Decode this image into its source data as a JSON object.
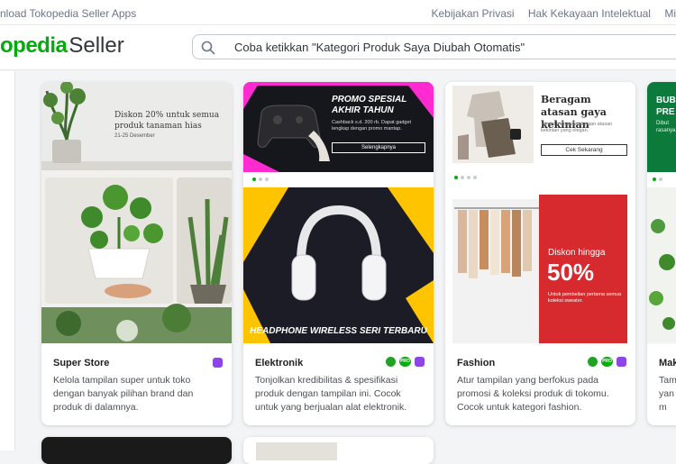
{
  "topbar": {
    "download_link": "nload Tokopedia Seller Apps",
    "privacy": "Kebijakan Privasi",
    "ip": "Hak Kekayaan Intelektual",
    "more": "Mi"
  },
  "header": {
    "logo_brand": "opedia",
    "logo_seller": "Seller",
    "search_placeholder": "Coba ketikkan \"Kategori Produk Saya Diubah Otomatis\""
  },
  "cards": [
    {
      "title": "Super Store",
      "description": "Kelola tampilan super untuk toko dengan banyak pilihan brand dan produk di dalamnya.",
      "banner_text": "Diskon 20% untuk semua produk tanaman hias",
      "banner_date": "21-25 Desember"
    },
    {
      "title": "Elektronik",
      "description": "Tonjolkan kredibilitas & spesifikasi produk dengan tampilan ini. Cocok untuk yang berjualan alat elektronik.",
      "promo_title": "PROMO SPESIAL AKHIR TAHUN",
      "promo_body": "Cashback s.d. 200 rb. Dapat gadget lengkap dengan promo mantap.",
      "promo_btn": "Selengkapnya",
      "headphone_text": "HEADPHONE WIRELESS SERI TERBARU"
    },
    {
      "title": "Fashion",
      "description": "Atur tampilan yang berfokus pada promosi & koleksi produk di tokomu. Cocok untuk kategori fashion.",
      "banner_title": "Beragam atasan gaya kekinian",
      "banner_body": "Tampil menawan dengan atasan kekinian yang elegan.",
      "banner_btn": "Cek Sekarang",
      "sale_label": "Diskon hingga",
      "sale_value": "50%",
      "sale_note": "Untuk pembelian pertama semua koleksi sweater."
    },
    {
      "title": "Mak",
      "description": "Tam\nyan\nm",
      "banner_title": "BUB\nPRE",
      "banner_body": "Dibut\nrasanya"
    }
  ],
  "colors": {
    "brand": "#03ac0e",
    "badge_purple": "#8e44ec",
    "promo_pink": "#ff2bd1",
    "fashion_red": "#d62a2e"
  }
}
